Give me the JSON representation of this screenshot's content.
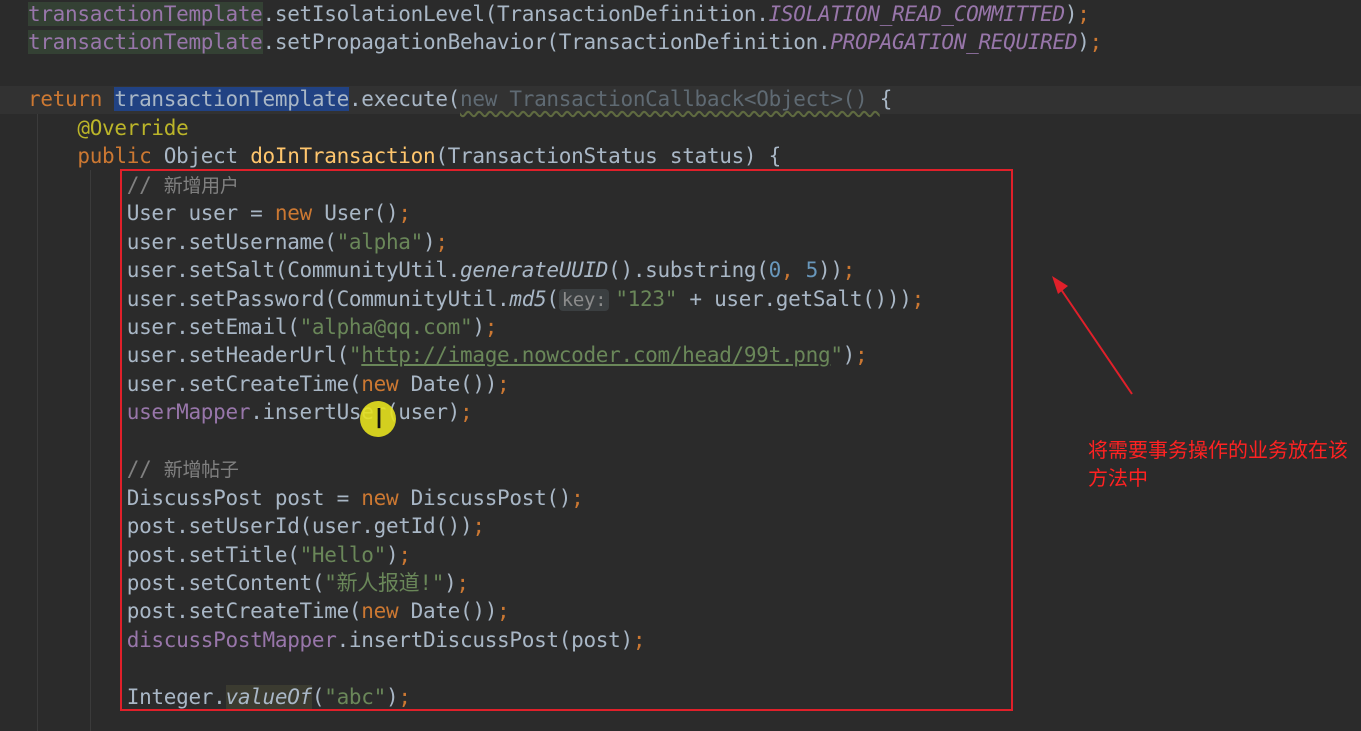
{
  "code_lines": [
    [
      [
        "c-field c-ident",
        "transactionTemplate"
      ],
      [
        "",
        ".setIsolationLevel(TransactionDefinition."
      ],
      [
        "c-const",
        "ISOLATION_READ_COMMITTED"
      ],
      [
        "",
        ")"
      ],
      [
        "c-punc",
        ";"
      ]
    ],
    [
      [
        "c-field c-ident",
        "transactionTemplate"
      ],
      [
        "",
        ".setPropagationBehavior(TransactionDefinition."
      ],
      [
        "c-const",
        "PROPAGATION_REQUIRED"
      ],
      [
        "",
        ")"
      ],
      [
        "c-punc",
        ";"
      ]
    ],
    [],
    [
      [
        "c-kw",
        "return "
      ],
      [
        "c-field c-sel",
        "transactionTemplate"
      ],
      [
        "",
        ".execute("
      ],
      [
        "c-dim",
        "new TransactionCallback<Object>() "
      ],
      [
        "",
        "{"
      ]
    ],
    [
      [
        "c-ann",
        "    @Override"
      ]
    ],
    [
      [
        "c-kw",
        "    public "
      ],
      [
        "",
        "Object "
      ],
      [
        "c-fn",
        "doInTransaction"
      ],
      [
        "",
        "(TransactionStatus status) {"
      ]
    ],
    [
      [
        "c-cmt",
        "        // "
      ],
      [
        "c-cmt cmt-cn",
        "新增用户"
      ]
    ],
    [
      [
        "",
        "        User user = "
      ],
      [
        "c-kw",
        "new "
      ],
      [
        "",
        "User()"
      ],
      [
        "c-punc",
        ";"
      ]
    ],
    [
      [
        "",
        "        user.setUsername("
      ],
      [
        "c-str",
        "\"alpha\""
      ],
      [
        "",
        ")"
      ],
      [
        "c-punc",
        ";"
      ]
    ],
    [
      [
        "",
        "        user.setSalt(CommunityUtil."
      ],
      [
        "c-static",
        "generateUUID"
      ],
      [
        "",
        "().substring("
      ],
      [
        "c-num",
        "0"
      ],
      [
        "c-punc",
        ", "
      ],
      [
        "c-num",
        "5"
      ],
      [
        "",
        "))"
      ],
      [
        "c-punc",
        ";"
      ]
    ],
    [
      [
        "",
        "        user.setPassword(CommunityUtil."
      ],
      [
        "c-static",
        "md5"
      ],
      [
        "",
        "("
      ],
      [
        "c-hint",
        "key:"
      ],
      [
        "c-str",
        "\"123\""
      ],
      [
        "",
        " + user.getSalt()))"
      ],
      [
        "c-punc",
        ";"
      ]
    ],
    [
      [
        "",
        "        user.setEmail("
      ],
      [
        "c-str",
        "\"alpha@qq.com\""
      ],
      [
        "",
        ")"
      ],
      [
        "c-punc",
        ";"
      ]
    ],
    [
      [
        "",
        "        user.setHeaderUrl("
      ],
      [
        "c-str",
        "\""
      ],
      [
        "c-url",
        "http://image.nowcoder.com/head/99t.png"
      ],
      [
        "c-str",
        "\""
      ],
      [
        "",
        ")"
      ],
      [
        "c-punc",
        ";"
      ]
    ],
    [
      [
        "",
        "        user.setCreateTime("
      ],
      [
        "c-kw",
        "new "
      ],
      [
        "",
        "Date())"
      ],
      [
        "c-punc",
        ";"
      ]
    ],
    [
      [
        "c-field",
        "        userMapper"
      ],
      [
        "",
        ".insertUser(user)"
      ],
      [
        "c-punc",
        ";"
      ]
    ],
    [],
    [
      [
        "c-cmt",
        "        // "
      ],
      [
        "c-cmt cmt-cn",
        "新增帖子"
      ]
    ],
    [
      [
        "",
        "        DiscussPost post = "
      ],
      [
        "c-kw",
        "new "
      ],
      [
        "",
        "DiscussPost()"
      ],
      [
        "c-punc",
        ";"
      ]
    ],
    [
      [
        "",
        "        post.setUserId(user.getId())"
      ],
      [
        "c-punc",
        ";"
      ]
    ],
    [
      [
        "",
        "        post.setTitle("
      ],
      [
        "c-str",
        "\"Hello\""
      ],
      [
        "",
        ")"
      ],
      [
        "c-punc",
        ";"
      ]
    ],
    [
      [
        "",
        "        post.setContent("
      ],
      [
        "c-str",
        "\"新人报道!\""
      ],
      [
        "",
        ")"
      ],
      [
        "c-punc",
        ";"
      ]
    ],
    [
      [
        "",
        "        post.setCreateTime("
      ],
      [
        "c-kw",
        "new "
      ],
      [
        "",
        "Date())"
      ],
      [
        "c-punc",
        ";"
      ]
    ],
    [
      [
        "c-field",
        "        discussPostMapper"
      ],
      [
        "",
        ".insertDiscussPost(post)"
      ],
      [
        "c-punc",
        ";"
      ]
    ],
    [],
    [
      [
        "",
        "        Integer."
      ],
      [
        "c-vo",
        "valueOf"
      ],
      [
        "",
        "("
      ],
      [
        "c-str",
        "\"abc\""
      ],
      [
        "",
        ")"
      ],
      [
        "c-punc",
        ";"
      ]
    ]
  ],
  "annotation": {
    "text": "将需要事务操作的业务放在该方法中",
    "color": "#ff2222"
  },
  "highlight_color": "#e0202a",
  "cursor": {
    "icon": "text-cursor-icon"
  }
}
